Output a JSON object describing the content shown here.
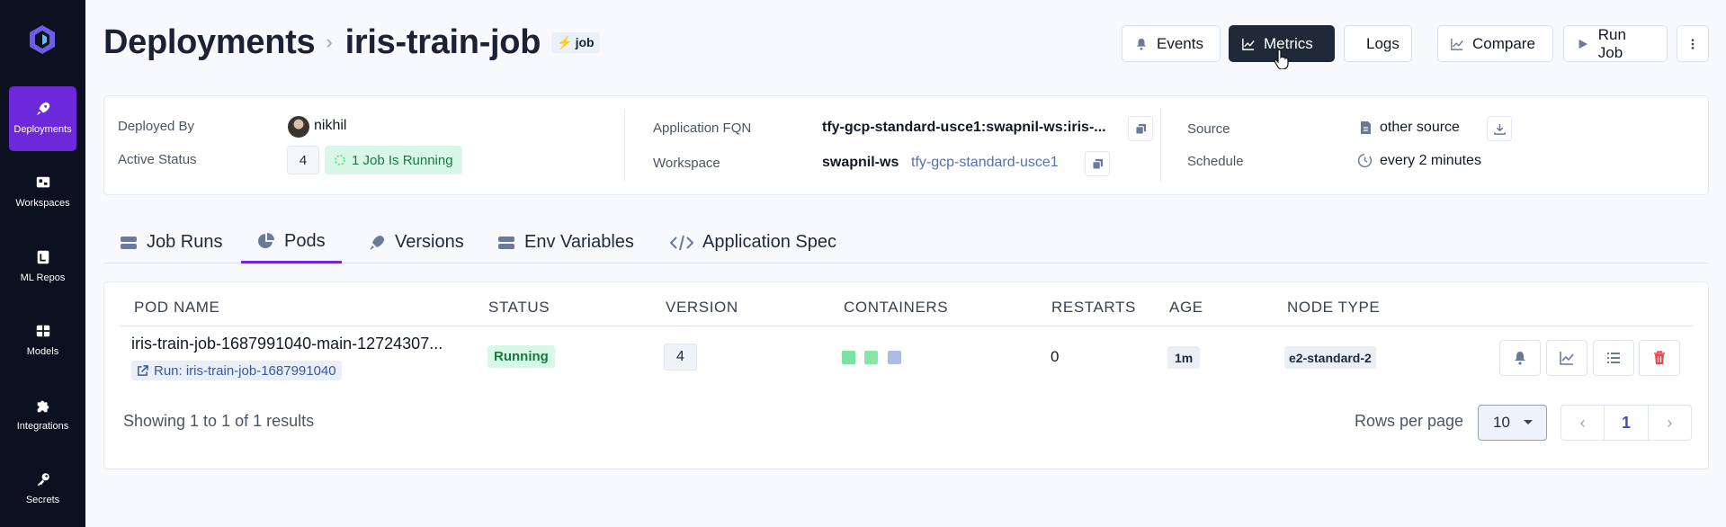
{
  "sidebar": {
    "items": [
      {
        "label": "Deployments",
        "icon": "rocket-icon",
        "active": true
      },
      {
        "label": "Workspaces",
        "icon": "workspace-icon"
      },
      {
        "label": "ML Repos",
        "icon": "repo-icon"
      },
      {
        "label": "Models",
        "icon": "grid-icon"
      },
      {
        "label": "Integrations",
        "icon": "puzzle-icon"
      },
      {
        "label": "Secrets",
        "icon": "key-icon"
      }
    ]
  },
  "header": {
    "breadcrumb_root": "Deployments",
    "title": "iris-train-job",
    "badge": "job",
    "buttons": {
      "events": "Events",
      "metrics": "Metrics",
      "logs": "Logs",
      "compare": "Compare",
      "run_job": "Run Job"
    }
  },
  "info": {
    "deployed_by_label": "Deployed By",
    "deployed_by": "nikhil",
    "active_status_label": "Active Status",
    "active_count": "4",
    "running_text": "1 Job Is Running",
    "fqn_label": "Application FQN",
    "fqn": "tfy-gcp-standard-usce1:swapnil-ws:iris-...",
    "workspace_label": "Workspace",
    "workspace": "swapnil-ws",
    "cluster": "tfy-gcp-standard-usce1",
    "source_label": "Source",
    "source": "other source",
    "schedule_label": "Schedule",
    "schedule": "every 2 minutes"
  },
  "tabs": [
    {
      "label": "Job Runs"
    },
    {
      "label": "Pods",
      "active": true
    },
    {
      "label": "Versions"
    },
    {
      "label": "Env Variables"
    },
    {
      "label": "Application Spec"
    }
  ],
  "table": {
    "columns": [
      "POD NAME",
      "STATUS",
      "VERSION",
      "CONTAINERS",
      "RESTARTS",
      "AGE",
      "NODE TYPE"
    ],
    "rows": [
      {
        "pod_name": "iris-train-job-1687991040-main-12724307...",
        "run_link": "Run: iris-train-job-1687991040",
        "status": "Running",
        "version": "4",
        "containers": [
          "#7be3a2",
          "#86e6a8",
          "#a9bde6"
        ],
        "restarts": "0",
        "age": "1m",
        "node_type": "e2-standard-2"
      }
    ],
    "showing": "Showing 1 to 1 of 1 results",
    "rows_per_page_label": "Rows per page",
    "rows_per_page": "10",
    "current_page": "1"
  },
  "colors": {
    "accent": "#6d28d9",
    "running_bg": "#d9f7e6",
    "running_text": "#157a43"
  }
}
